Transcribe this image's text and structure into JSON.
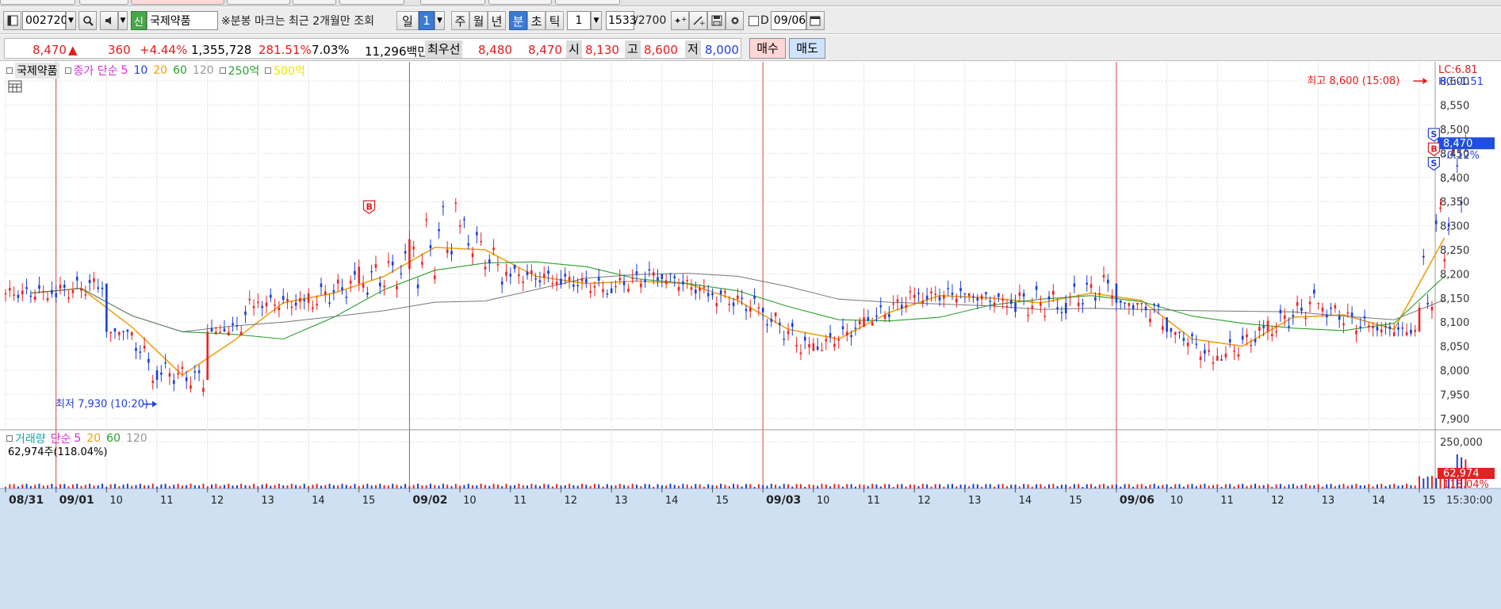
{
  "toolbar": {
    "code": "002720",
    "flag": "신",
    "stock_name": "국제약품",
    "notice": "※분봉 마크는 최근 2개월만 조회",
    "periods": [
      "일",
      "1",
      "주",
      "월",
      "년",
      "분",
      "초",
      "틱"
    ],
    "selected_period": "분",
    "interval": "1",
    "count": "1533",
    "total": "/2700",
    "date_label": "D",
    "date": "09/06"
  },
  "quote": {
    "price": "8,470",
    "change_arrow": "▲",
    "change": "360",
    "change_pct": "+4.44%",
    "volume": "1,355,728",
    "volume_ratio": "281.51%",
    "turnover": "7.03%",
    "amount": "11,296백만",
    "best_label": "최우선",
    "best_ask": "8,480",
    "best_bid": "8,470",
    "open_label": "시",
    "open": "8,130",
    "high_label": "고",
    "high": "8,600",
    "low_label": "저",
    "low": "8,000",
    "buy_label": "매수",
    "sell_label": "매도"
  },
  "price_panel": {
    "legend": {
      "name": "국제약품",
      "type": "종가 단순",
      "ma5": "5",
      "ma10": "10",
      "ma20": "20",
      "ma60": "60",
      "ma120": "120",
      "ma250": "250억",
      "ma500": "500억"
    },
    "lc": "LC:6.81",
    "hc": "HC:-1.51",
    "current_price": "8,470",
    "current_pct": "-0.12%",
    "high_annotation": "최고 8,600 (15:08)",
    "low_annotation": "최저 7,930 (10:20)",
    "signals": [
      "B",
      "S",
      "B",
      "S"
    ]
  },
  "volume_panel": {
    "legend": {
      "label": "거래량",
      "type": "단순",
      "ma5": "5",
      "ma20": "20",
      "ma60": "60",
      "ma120": "120"
    },
    "info": "62,974주(118.04%)",
    "axis_top": "250,000",
    "current": "62,974",
    "current_pct": "118.04%"
  },
  "x_axis": {
    "labels": [
      "08/31",
      "09/01",
      "10",
      "11",
      "12",
      "13",
      "14",
      "15",
      "09/02",
      "10",
      "11",
      "12",
      "13",
      "14",
      "15",
      "09/03",
      "10",
      "11",
      "12",
      "13",
      "14",
      "15",
      "09/06",
      "10",
      "11",
      "12",
      "13",
      "14",
      "15"
    ],
    "end_time": "15:30:00"
  },
  "chart_data": {
    "type": "line",
    "title": "국제약품",
    "series_type": "1-minute candlestick with simple moving averages",
    "y_axis_ticks": [
      7900,
      7950,
      8000,
      8050,
      8100,
      8150,
      8200,
      8250,
      8300,
      8350,
      8400,
      8450,
      8500,
      8550,
      8600
    ],
    "ylim": [
      7880,
      8620
    ],
    "sessions": [
      "08/31",
      "09/01",
      "09/02",
      "09/03",
      "09/06"
    ],
    "x": [
      "08/31 15",
      "09/01 09",
      "09/01 10",
      "09/01 11",
      "09/01 12",
      "09/01 13",
      "09/01 14",
      "09/01 15",
      "09/02 09",
      "09/02 10",
      "09/02 11",
      "09/02 12",
      "09/02 13",
      "09/02 14",
      "09/02 15",
      "09/03 09",
      "09/03 10",
      "09/03 11",
      "09/03 12",
      "09/03 13",
      "09/03 14",
      "09/03 15",
      "09/06 09",
      "09/06 10",
      "09/06 11",
      "09/06 12",
      "09/06 13",
      "09/06 14",
      "09/06 15"
    ],
    "series": [
      {
        "name": "종가",
        "values": [
          8160,
          8180,
          8000,
          7980,
          8140,
          8140,
          8180,
          8210,
          8300,
          8200,
          8190,
          8170,
          8200,
          8160,
          8130,
          8040,
          8090,
          8150,
          8160,
          8140,
          8140,
          8180,
          8110,
          8020,
          8080,
          8140,
          8090,
          8080,
          8470
        ]
      },
      {
        "name": "최고",
        "values": [
          8200,
          8230,
          8080,
          8040,
          8200,
          8170,
          8240,
          8330,
          8510,
          8320,
          8220,
          8220,
          8240,
          8200,
          8170,
          8120,
          8110,
          8190,
          8190,
          8160,
          8250,
          8230,
          8140,
          8080,
          8120,
          8180,
          8140,
          8100,
          8600
        ]
      },
      {
        "name": "최저",
        "values": [
          8140,
          8140,
          7960,
          7930,
          8080,
          8110,
          8120,
          8150,
          8140,
          8150,
          8150,
          8150,
          8160,
          8140,
          8080,
          8000,
          8040,
          8100,
          8130,
          8110,
          8100,
          8090,
          8010,
          8000,
          8020,
          8060,
          8040,
          8070,
          8080
        ]
      }
    ],
    "volume": {
      "ylim": [
        0,
        260000
      ],
      "tick": 250000,
      "last": 62974
    }
  }
}
